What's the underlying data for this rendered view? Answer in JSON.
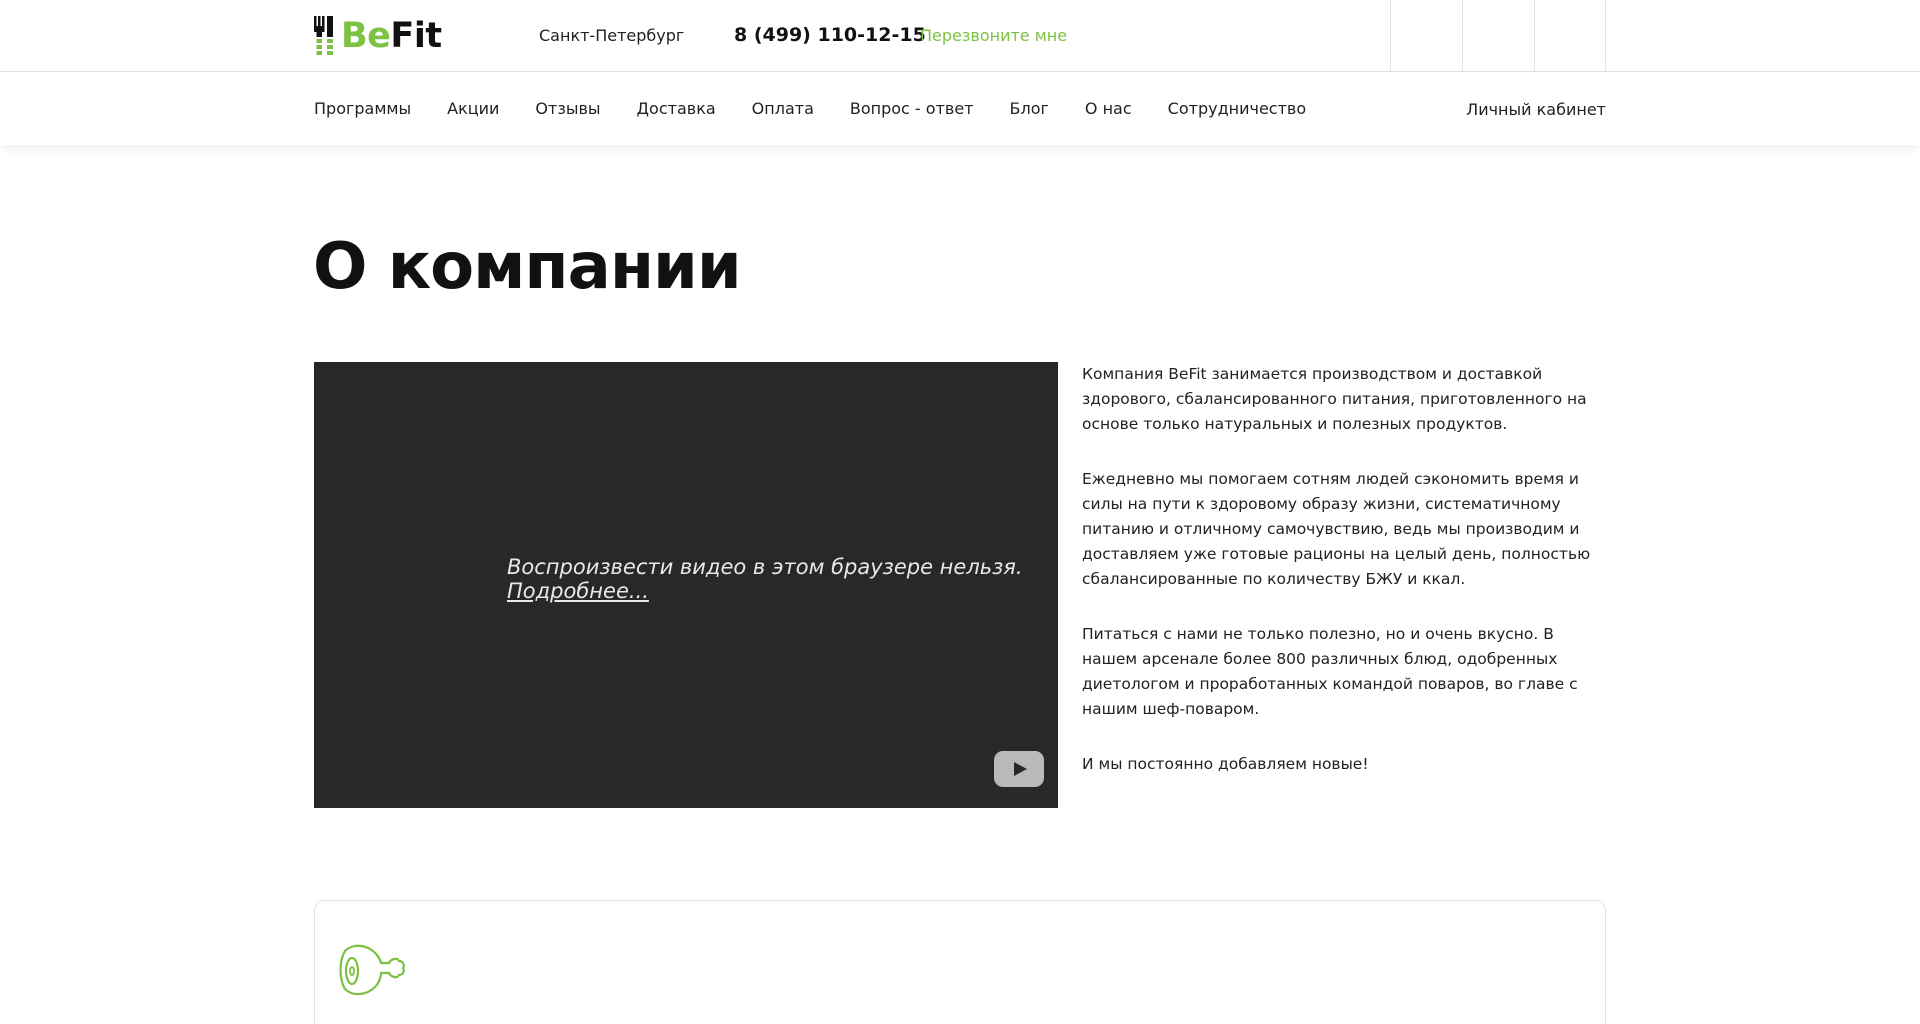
{
  "header": {
    "logo": {
      "part1": "Be",
      "part2": "Fit"
    },
    "city": "Санкт-Петербург",
    "phone": "8 (499) 110-12-15",
    "callback_label": "Перезвоните мне"
  },
  "nav": {
    "items": [
      {
        "label": "Программы"
      },
      {
        "label": "Акции"
      },
      {
        "label": "Отзывы"
      },
      {
        "label": "Доставка"
      },
      {
        "label": "Оплата"
      },
      {
        "label": "Вопрос - ответ"
      },
      {
        "label": "Блог"
      },
      {
        "label": "О нас"
      },
      {
        "label": "Сотрудничество"
      }
    ],
    "account_label": "Личный кабинет"
  },
  "main": {
    "title": "О компании",
    "video": {
      "message": "Воспроизвести видео в этом браузере нельзя.",
      "more_link": "Подробнее..."
    },
    "paragraphs": [
      "Компания BeFit занимается производством и доставкой здорового, сбалансированного питания, приготовленного на основе только натуральных и полезных продуктов.",
      "Ежедневно мы помогаем сотням людей сэкономить время и силы на пути к здоровому образу жизни, систематичному питанию и отличному самочувствию, ведь мы производим и доставляем уже готовые рационы на целый день, полностью сбалансированные по количеству БЖУ и ккал.",
      "Питаться с нами не только полезно, но и очень вкусно. В нашем арсенале более 800 различных блюд, одобренных диетологом и проработанных командой поваров, во главе с нашим шеф-поваром.",
      "И мы постоянно добавляем новые!"
    ]
  },
  "colors": {
    "accent": "#7dc142",
    "video_bg": "#282828"
  },
  "icons": [
    "fork-knife-icon",
    "youtube-play-icon",
    "meat-leg-icon"
  ]
}
